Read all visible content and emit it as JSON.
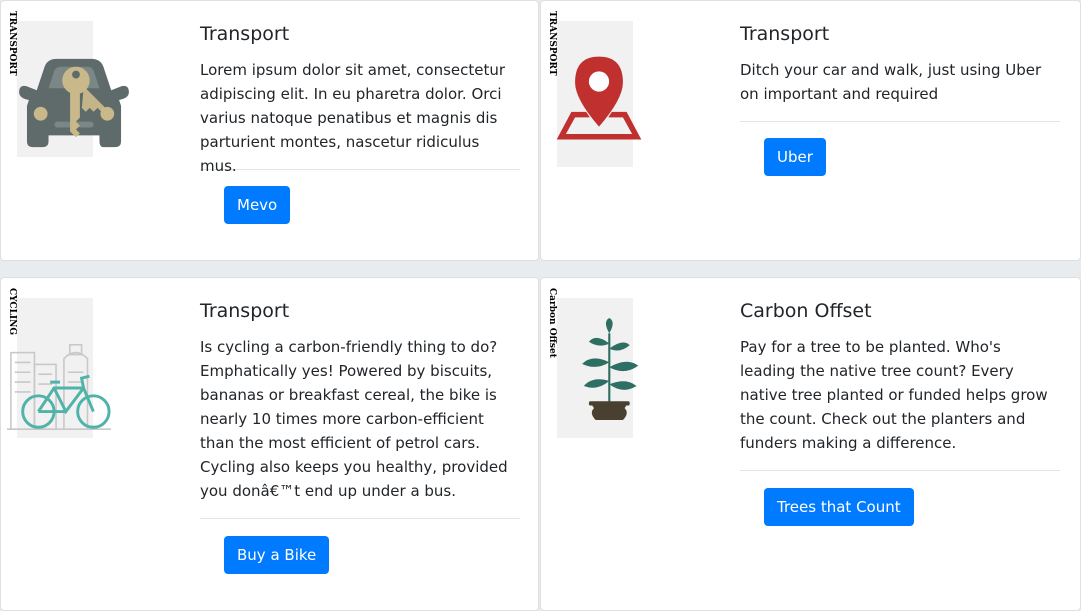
{
  "cards": [
    {
      "side_label": "TRANSPORT",
      "icon": "car-key-icon",
      "title": "Transport",
      "text": "Lorem ipsum dolor sit amet, consectetur adipiscing elit. In eu pharetra dolor. Orci varius natoque penatibus et magnis dis parturient montes, nascetur ridiculus mus.",
      "button": "Mevo"
    },
    {
      "side_label": "TRANSPORT",
      "icon": "map-pin-icon",
      "title": "Transport",
      "text": "Ditch your car and walk, just using Uber on important and required",
      "button": "Uber"
    },
    {
      "side_label": "CYCLING",
      "icon": "bicycle-city-icon",
      "title": "Transport",
      "text": "Is cycling a carbon-friendly thing to do? Emphatically yes! Powered by biscuits, bananas or breakfast cereal, the bike is nearly 10 times more carbon-efficient than the most efficient of petrol cars. Cycling also keeps you healthy, provided you donâ€™t end up under a bus.",
      "button": "Buy a Bike"
    },
    {
      "side_label": "Carbon Offset",
      "icon": "potted-plant-icon",
      "title": "Carbon Offset",
      "text": "Pay for a tree to be planted. Who's leading the native tree count? Every native tree planted or funded helps grow the count. Check out the planters and funders making a difference.",
      "button": "Trees that Count"
    }
  ],
  "colors": {
    "primary": "#007bff",
    "page_background": "#e9ecef",
    "pin_red": "#c0302e",
    "car_gray": "#5f6b6b",
    "key_tan": "#c9b98a",
    "bike_teal": "#4fb3a9",
    "leaf_green": "#2e6e63",
    "pot_brown": "#4a4030"
  }
}
